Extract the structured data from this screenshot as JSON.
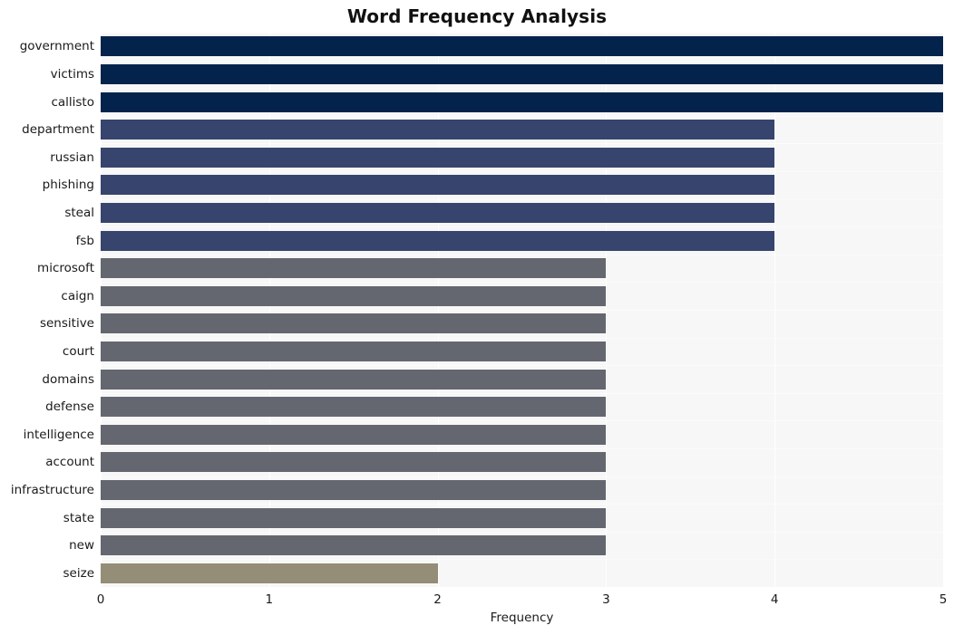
{
  "chart_data": {
    "type": "bar",
    "orientation": "horizontal",
    "title": "Word Frequency Analysis",
    "xlabel": "Frequency",
    "ylabel": "",
    "xlim": [
      0,
      5
    ],
    "xticks": [
      0,
      1,
      2,
      3,
      4,
      5
    ],
    "xtick_labels": [
      "0",
      "1",
      "2",
      "3",
      "4",
      "5"
    ],
    "grid": true,
    "legend": "none",
    "categories": [
      "government",
      "victims",
      "callisto",
      "department",
      "russian",
      "phishing",
      "steal",
      "fsb",
      "microsoft",
      "caign",
      "sensitive",
      "court",
      "domains",
      "defense",
      "intelligence",
      "account",
      "infrastructure",
      "state",
      "new",
      "seize"
    ],
    "values": [
      5,
      5,
      5,
      4,
      4,
      4,
      4,
      4,
      3,
      3,
      3,
      3,
      3,
      3,
      3,
      3,
      3,
      3,
      3,
      2
    ],
    "bar_colors": [
      "#04234c",
      "#04234c",
      "#04234c",
      "#36446e",
      "#36446e",
      "#36446e",
      "#36446e",
      "#36446e",
      "#64676f",
      "#64676f",
      "#64676f",
      "#64676f",
      "#64676f",
      "#64676f",
      "#64676f",
      "#64676f",
      "#64676f",
      "#64676f",
      "#64676f",
      "#948d77"
    ],
    "palette": {
      "value_5": "#04234c",
      "value_4": "#36446e",
      "value_3": "#64676f",
      "value_2": "#948d77",
      "plot_background": "#f7f7f7",
      "figure_background": "#ffffff",
      "gridline": "#ffffff",
      "text": "#1a1a1a"
    }
  }
}
